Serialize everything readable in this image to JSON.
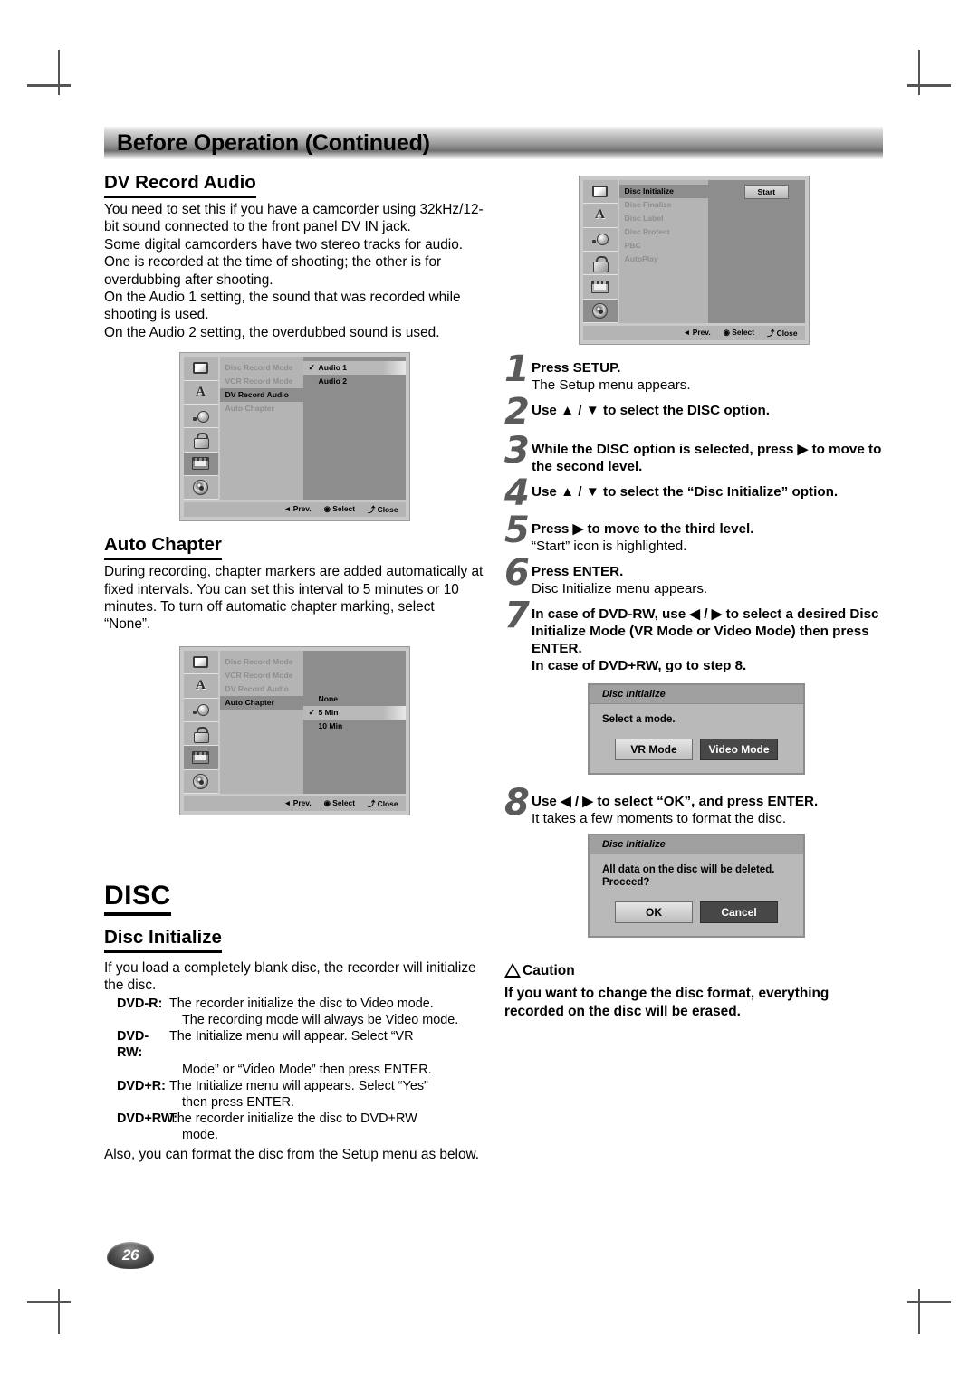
{
  "header": {
    "title": "Before Operation (Continued)"
  },
  "page_number": "26",
  "left": {
    "dv_record_audio": {
      "heading": "DV Record Audio",
      "paragraph": "You need to set this if you have a camcorder using 32kHz/12-bit sound connected to the front panel DV IN jack.\nSome digital camcorders have two stereo tracks for audio. One is recorded at the time of shooting; the other is for overdubbing after shooting.\nOn the Audio 1 setting, the sound that was recorded while shooting is used.\nOn the Audio 2 setting, the overdubbed sound is used."
    },
    "auto_chapter": {
      "heading": "Auto Chapter",
      "paragraph": "During recording, chapter markers are added automatically at fixed intervals. You can set this interval to 5 minutes or 10 minutes. To turn off automatic chapter marking, select “None”."
    },
    "disc": {
      "heading": "DISC",
      "sub_heading": "Disc Initialize",
      "intro": "If you load a completely blank disc, the recorder will initialize the disc.",
      "formats": [
        {
          "term": "DVD-R:",
          "lines": [
            "The recorder initialize the disc to Video mode.",
            "The recording mode will always be Video mode."
          ]
        },
        {
          "term": "DVD-RW:",
          "lines": [
            "The Initialize menu will appear. Select “VR",
            "Mode” or “Video Mode” then press ENTER."
          ]
        },
        {
          "term": "DVD+R:",
          "lines": [
            "The Initialize menu will appears. Select “Yes”",
            "then press ENTER."
          ]
        },
        {
          "term": "DVD+RW:",
          "lines": [
            "The recorder initialize the disc to DVD+RW",
            "mode."
          ]
        }
      ],
      "outro": "Also, you can format the disc from the Setup menu as below."
    }
  },
  "osd_dv_record_audio": {
    "sidebar_icons": [
      "tv-icon",
      "language-icon",
      "audio-icon",
      "lock-icon",
      "film-icon",
      "disc-icon"
    ],
    "selected_icon_index": 4,
    "menu_items": [
      {
        "label": "Disc Record Mode",
        "state": "dim"
      },
      {
        "label": "VCR Record Mode",
        "state": "dim"
      },
      {
        "label": "DV Record Audio",
        "state": "active"
      },
      {
        "label": "Auto Chapter",
        "state": "dim"
      }
    ],
    "options": [
      {
        "label": "Audio 1",
        "checked": true,
        "highlighted": true
      },
      {
        "label": "Audio 2",
        "checked": false,
        "highlighted": false
      }
    ],
    "footer": {
      "prev": "◄ Prev.",
      "select": "◉ Select",
      "close": "⤴ Close"
    }
  },
  "osd_auto_chapter": {
    "sidebar_icons": [
      "tv-icon",
      "language-icon",
      "audio-icon",
      "lock-icon",
      "film-icon",
      "disc-icon"
    ],
    "selected_icon_index": 4,
    "menu_items": [
      {
        "label": "Disc Record Mode",
        "state": "dim"
      },
      {
        "label": "VCR Record Mode",
        "state": "dim"
      },
      {
        "label": "DV Record Audio",
        "state": "dim"
      },
      {
        "label": "Auto Chapter",
        "state": "active"
      }
    ],
    "options": [
      {
        "label": "None",
        "checked": false,
        "highlighted": false
      },
      {
        "label": "5 Min",
        "checked": true,
        "highlighted": true
      },
      {
        "label": "10 Min",
        "checked": false,
        "highlighted": false
      }
    ],
    "footer": {
      "prev": "◄ Prev.",
      "select": "◉ Select",
      "close": "⤴ Close"
    }
  },
  "osd_disc_initialize": {
    "sidebar_icons": [
      "tv-icon",
      "language-icon",
      "audio-icon",
      "lock-icon",
      "film-icon",
      "disc-icon"
    ],
    "selected_icon_index": 5,
    "menu_items": [
      {
        "label": "Disc Initialize",
        "state": "active"
      },
      {
        "label": "Disc Finalize",
        "state": "dim"
      },
      {
        "label": "Disc Label",
        "state": "dim"
      },
      {
        "label": "Disc Protect",
        "state": "dim"
      },
      {
        "label": "PBC",
        "state": "dim"
      },
      {
        "label": "AutoPlay",
        "state": "dim"
      }
    ],
    "start_button": "Start",
    "footer": {
      "prev": "◄ Prev.",
      "select": "◉ Select",
      "close": "⤴ Close"
    }
  },
  "steps": [
    {
      "num": "1",
      "bold": "Press SETUP.",
      "plain": "The Setup menu appears."
    },
    {
      "num": "2",
      "bold": "Use ▲ / ▼ to select the DISC option.",
      "plain": ""
    },
    {
      "num": "3",
      "bold": "While the DISC option is selected, press ▶ to move to the second level.",
      "plain": ""
    },
    {
      "num": "4",
      "bold": "Use ▲ / ▼ to select the “Disc Initialize” option.",
      "plain": ""
    },
    {
      "num": "5",
      "bold": "Press ▶ to move to the third level.",
      "plain": "“Start” icon is highlighted."
    },
    {
      "num": "6",
      "bold": "Press ENTER.",
      "plain": "Disc Initialize menu appears."
    },
    {
      "num": "7",
      "bold": "In case of DVD-RW, use ◀ / ▶ to select a desired Disc Initialize Mode (VR Mode or Video Mode) then press ENTER.\nIn case of DVD+RW, go to step 8.",
      "plain": ""
    },
    {
      "num": "8",
      "bold": "Use ◀ / ▶ to select “OK”, and press ENTER.",
      "plain": "It takes a few moments to format the disc."
    }
  ],
  "dialog_mode": {
    "title": "Disc Initialize",
    "message": "Select a mode.",
    "buttons": [
      {
        "label": "VR Mode",
        "style": "light"
      },
      {
        "label": "Video Mode",
        "style": "dark"
      }
    ]
  },
  "dialog_confirm": {
    "title": "Disc Initialize",
    "message": "All data on the disc will be deleted.\nProceed?",
    "buttons": [
      {
        "label": "OK",
        "style": "light"
      },
      {
        "label": "Cancel",
        "style": "dark"
      }
    ]
  },
  "caution": {
    "label": "Caution",
    "body": "If you want to change the disc format, everything recorded on the disc will be erased."
  }
}
